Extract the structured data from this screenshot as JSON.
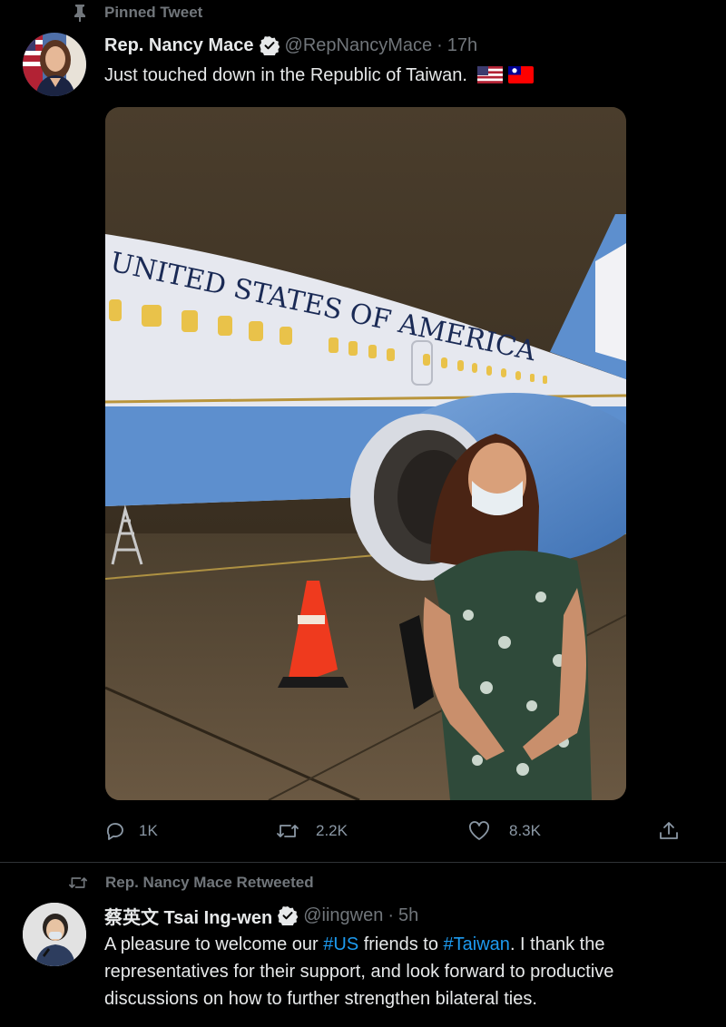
{
  "pinned_tweet": {
    "context_label": "Pinned Tweet",
    "author_name": "Rep. Nancy Mace",
    "handle": "@RepNancyMace",
    "dot": "·",
    "time": "17h",
    "text": "Just touched down in the Republic of Taiwan.",
    "flags": [
      "flag-us-icon",
      "flag-taiwan-icon"
    ],
    "actions": {
      "reply_count": "1K",
      "retweet_count": "2.2K",
      "like_count": "8.3K"
    },
    "photo": {
      "fuselage_text": "UNITED STATES OF AMERICA"
    }
  },
  "retweeted_tweet": {
    "context_label": "Rep. Nancy Mace Retweeted",
    "author_name": "蔡英文 Tsai Ing-wen",
    "handle": "@iingwen",
    "dot": "·",
    "time": "5h",
    "text_parts": {
      "p1": "A pleasure to welcome our ",
      "tag1": "#US",
      "p2": " friends to ",
      "tag2": "#Taiwan",
      "p3": ". I thank the representatives for their support, and look forward to productive discussions on how to further strengthen bilateral ties."
    }
  },
  "colors": {
    "background": "#000000",
    "text": "#e7e9ea",
    "secondary": "#71767b",
    "link": "#1d9bf0",
    "verified_badge": "#e7e9ea"
  }
}
